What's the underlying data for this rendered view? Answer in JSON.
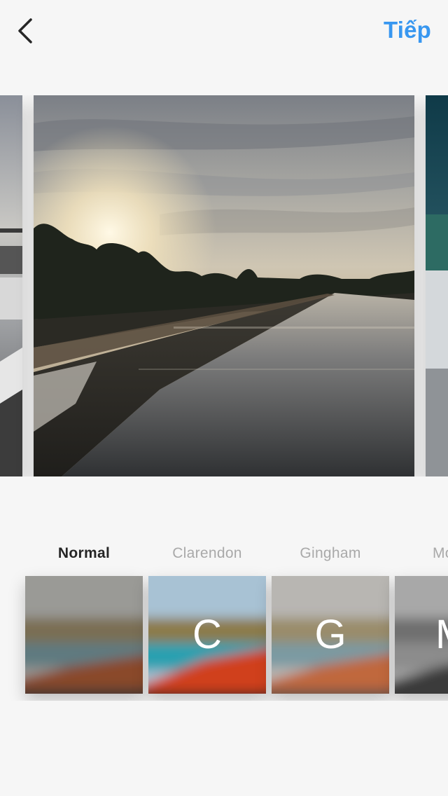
{
  "header": {
    "back_icon": "chevron-left-icon",
    "next_label": "Tiếp",
    "accent_color": "#3897f0"
  },
  "filters": [
    {
      "label": "Normal",
      "letter": "",
      "selected": true
    },
    {
      "label": "Clarendon",
      "letter": "C",
      "selected": false
    },
    {
      "label": "Gingham",
      "letter": "G",
      "selected": false
    },
    {
      "label": "Mo",
      "letter": "M",
      "selected": false
    }
  ]
}
